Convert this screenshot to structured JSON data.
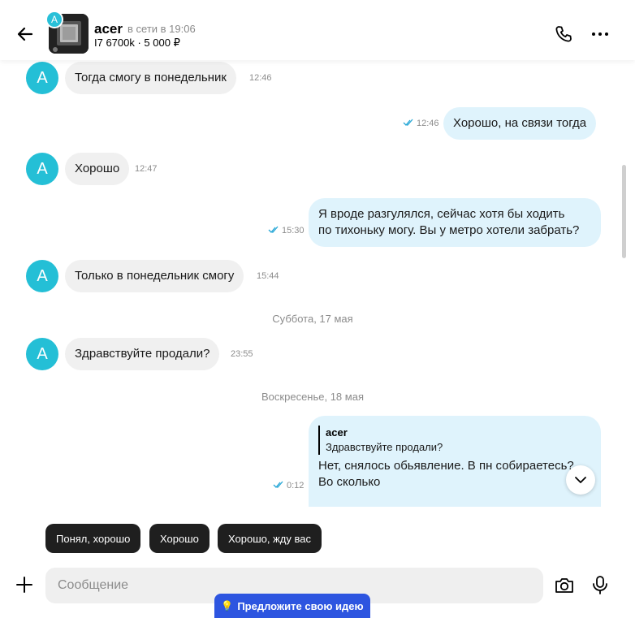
{
  "header": {
    "contact_name": "acer",
    "status": "в сети в 19:06",
    "item": "I7 6700k · 5 000 ₽",
    "badge_letter": "A"
  },
  "messages": [
    {
      "dir": "in",
      "text": "Тогда смогу в понедельник",
      "time": "12:46",
      "avatar": "A"
    },
    {
      "dir": "out",
      "text": "Хорошо, на связи тогда",
      "time": "12:46"
    },
    {
      "dir": "in",
      "text": "Хорошо",
      "time": "12:47",
      "avatar": "A"
    },
    {
      "dir": "out",
      "text_line1": "Я вроде разгулялся, сейчас хотя бы ходить",
      "text_line2": "по тихоньку могу. Вы у метро хотели забрать?",
      "time": "15:30"
    },
    {
      "dir": "in",
      "text": "Только в понедельник смогу",
      "time": "15:44",
      "avatar": "A"
    },
    {
      "dir": "in",
      "text": "Здравствуйте продали?",
      "time": "23:55",
      "avatar": "A"
    },
    {
      "dir": "out",
      "reply_name": "acer",
      "reply_text": "Здравствуйте продали?",
      "text_line1": "Нет, снялось обьявление. В пн собираетесь?",
      "text_line2": "Во сколько",
      "time": "0:12"
    }
  ],
  "dates": [
    "Суббота, 17 мая",
    "Воскресенье, 18 мая"
  ],
  "quick_replies": [
    "Понял, хорошо",
    "Хорошо",
    "Хорошо, жду вас"
  ],
  "composer": {
    "placeholder": "Сообщение"
  },
  "feedback": {
    "label": "Предложите свою идею"
  },
  "colors": {
    "accent": "#24bfd6",
    "outgoing_bubble": "#dff3fc",
    "incoming_bubble": "#f0f0f0",
    "feedback": "#2d55e0"
  }
}
